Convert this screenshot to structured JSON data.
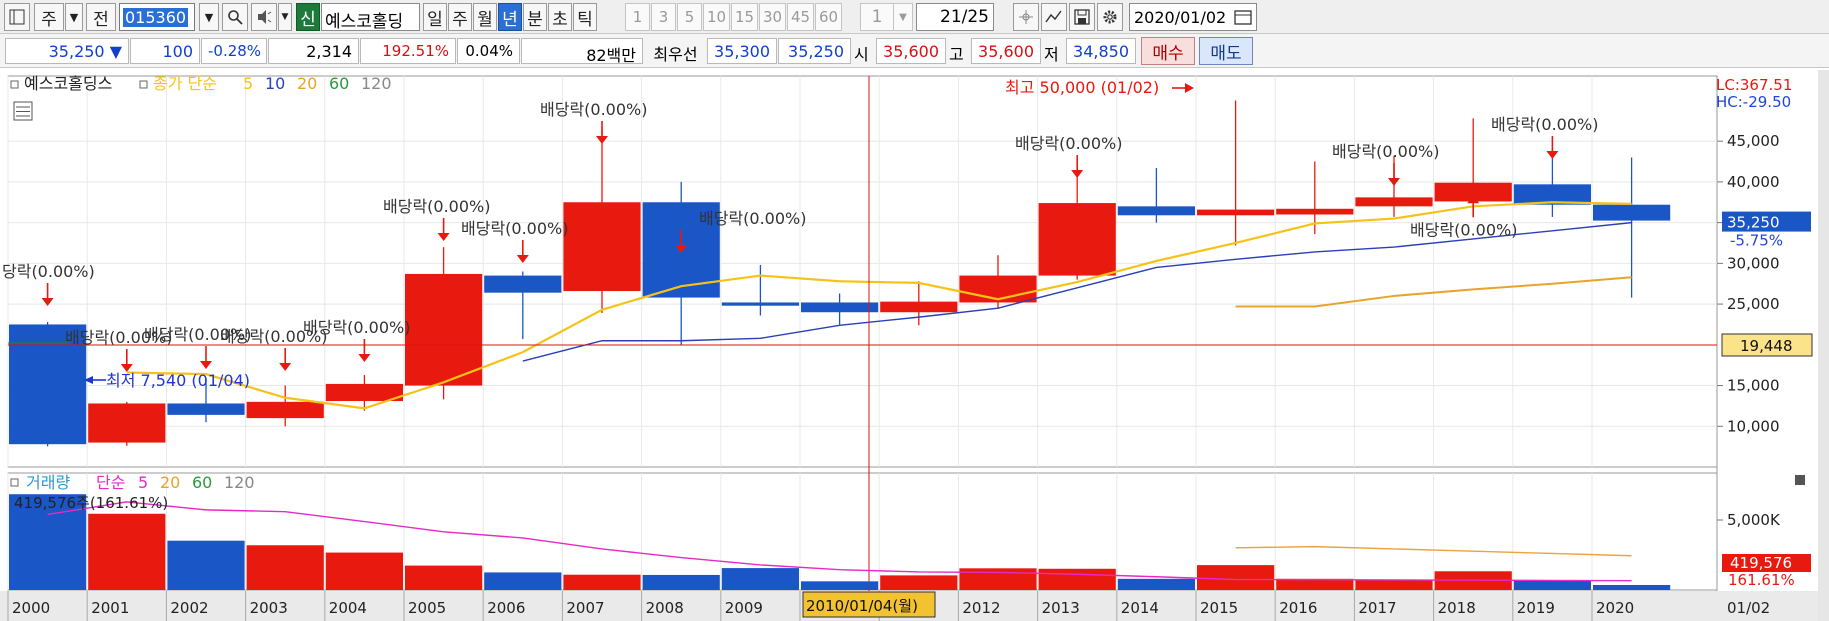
{
  "toolbar": {
    "period_label": "주",
    "prev_label": "전",
    "code": "015360",
    "stock_name": "예스코홀딩",
    "new_label": "신",
    "period_buttons": [
      "일",
      "주",
      "월",
      "년",
      "분",
      "초",
      "틱"
    ],
    "active_period": "년",
    "interval_buttons": [
      "1",
      "3",
      "5",
      "10",
      "15",
      "30",
      "45",
      "60"
    ],
    "count_value": "1",
    "page_current": "21",
    "page_total": "/25",
    "date": "2020/01/02"
  },
  "quote": {
    "price": "35,250",
    "change": "100",
    "change_rate": "-0.28%",
    "volume": "2,314",
    "volume_rate": "192.51%",
    "turnover": "0.04%",
    "amount": "82백만",
    "best_label": "최우선",
    "best_ask": "35,300",
    "best_bid": "35,250",
    "open_label": "시",
    "open": "35,600",
    "high_label": "고",
    "high": "35,600",
    "low_label": "저",
    "low": "34,850",
    "buy_label": "매수",
    "sell_label": "매도"
  },
  "chart_data": {
    "type": "candlestick",
    "legend_main": {
      "name": "예스코홀딩스",
      "ma_label": "종가 단순",
      "ma_periods": [
        "5",
        "10",
        "20",
        "60",
        "120"
      ]
    },
    "legend_volume": {
      "name": "거래량",
      "ma_label": "단순",
      "ma_periods": [
        "5",
        "20",
        "60",
        "120"
      ]
    },
    "categories": [
      "2000",
      "2001",
      "2002",
      "2003",
      "2004",
      "2005",
      "2006",
      "2007",
      "2008",
      "2009",
      "2010",
      "2011",
      "2012",
      "2013",
      "2014",
      "2015",
      "2016",
      "2017",
      "2018",
      "2019",
      "2020"
    ],
    "ohlc": [
      [
        22500,
        22800,
        7540,
        7800
      ],
      [
        8000,
        13000,
        7600,
        12800
      ],
      [
        12800,
        15800,
        10500,
        11400
      ],
      [
        11000,
        15000,
        10000,
        13000
      ],
      [
        13100,
        16300,
        11900,
        15200
      ],
      [
        15000,
        32000,
        13300,
        28700
      ],
      [
        28500,
        29000,
        20700,
        26400
      ],
      [
        26600,
        46500,
        23900,
        37500
      ],
      [
        37500,
        40000,
        20000,
        25800
      ],
      [
        25200,
        29800,
        23600,
        24800
      ],
      [
        25200,
        26300,
        22500,
        24000
      ],
      [
        24000,
        27800,
        22400,
        25300
      ],
      [
        25200,
        31000,
        24400,
        28500
      ],
      [
        28500,
        41200,
        28000,
        37400
      ],
      [
        37000,
        41700,
        35000,
        35900
      ],
      [
        35900,
        50000,
        32200,
        36600
      ],
      [
        36000,
        42500,
        33600,
        36700
      ],
      [
        37000,
        43200,
        35700,
        38100
      ],
      [
        37600,
        47800,
        37000,
        39900
      ],
      [
        39700,
        44000,
        35700,
        37200
      ],
      [
        37200,
        43000,
        25800,
        35250
      ]
    ],
    "ma5": [
      null,
      16600,
      16400,
      13500,
      12200,
      15400,
      19100,
      24300,
      27200,
      28500,
      27800,
      27600,
      25600,
      27700,
      30300,
      32500,
      34900,
      35500,
      37000,
      37500,
      37300
    ],
    "ma10": [
      null,
      null,
      null,
      null,
      null,
      null,
      18000,
      20500,
      20500,
      20800,
      22400,
      23400,
      24500,
      27000,
      29500,
      30500,
      31400,
      32000,
      33000,
      34000,
      35000
    ],
    "ma20": [
      null,
      null,
      null,
      null,
      null,
      null,
      null,
      null,
      null,
      null,
      null,
      null,
      null,
      null,
      null,
      24700,
      24700,
      26000,
      26800,
      27500,
      28300
    ],
    "volume": [
      419576,
      334000,
      216000,
      196000,
      164000,
      107000,
      77000,
      67000,
      66000,
      96000,
      38000,
      64000,
      95000,
      93000,
      49000,
      109000,
      49000,
      43000,
      82000,
      43000,
      22000
    ],
    "volume_ma5": [
      331000,
      386000,
      351000,
      343000,
      300000,
      255000,
      228000,
      180000,
      142000,
      110000,
      89000,
      79000,
      77000,
      69000,
      58000,
      46000,
      45000,
      44000,
      43000,
      42000,
      41000
    ],
    "volume_ma20": [
      null,
      null,
      null,
      null,
      null,
      null,
      null,
      null,
      null,
      null,
      null,
      null,
      null,
      null,
      null,
      185000,
      190000,
      180000,
      170000,
      160000,
      150000
    ],
    "y_ticks": [
      "45,000",
      "40,000",
      "35,000",
      "30,000",
      "25,000",
      "15,000",
      "10,000"
    ],
    "ylim": [
      5000,
      53000
    ],
    "volume_tick": "5,000K",
    "volume_ylim": [
      0,
      460000
    ],
    "dividend_label": "배당락(0.00%)",
    "dividend_label_clipped": "당락(0.00%)",
    "high_annotation": "최고 50,000 (01/02)",
    "low_annotation": "최저 7,540 (01/04)",
    "volume_annotation": "419,576주(161.61%)",
    "crosshair_date": "2010/01/04(월)",
    "crosshair_price": "19,448",
    "current_price_tag": "35,250",
    "current_change_tag": "-5.75%",
    "lc_label": "LC:367.51",
    "hc_label": "HC:-29.50",
    "volume_tag": "419,576",
    "volume_rate_tag": "161.61%",
    "end_date_label": "01/02",
    "colors": {
      "up": "#e8190e",
      "down": "#1a56c6",
      "ma5": "#f7c218",
      "ma10": "#2a3fb8",
      "ma20": "#e8a42a",
      "vol_ma5": "#e52ac6",
      "vol_ma20": "#f0a040",
      "cross": "#e01010"
    }
  }
}
